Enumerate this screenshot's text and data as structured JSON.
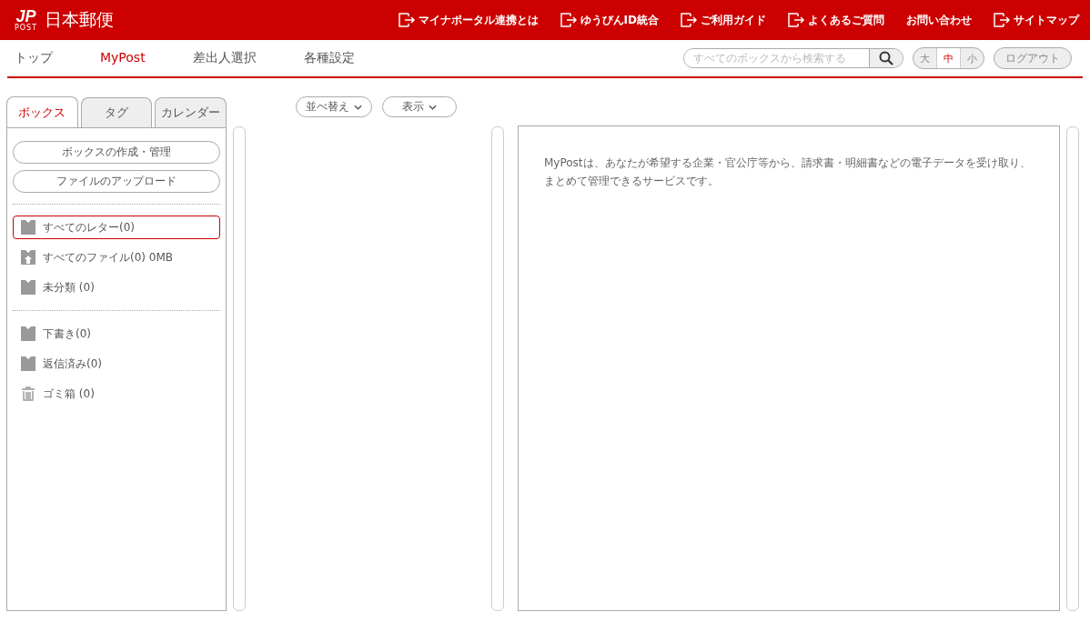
{
  "header": {
    "logo_mark": "JP",
    "logo_sub": "POST",
    "logo_text": "日本郵便",
    "links": [
      {
        "label": "マイナポータル連携とは",
        "external": true
      },
      {
        "label": "ゆうびんID統合",
        "external": true
      },
      {
        "label": "ご利用ガイド",
        "external": true
      },
      {
        "label": "よくあるご質問",
        "external": true
      },
      {
        "label": "お問い合わせ",
        "external": false
      },
      {
        "label": "サイトマップ",
        "external": true
      }
    ]
  },
  "nav": {
    "items": [
      {
        "label": "トップ",
        "selected": false
      },
      {
        "label": "MyPost",
        "selected": true
      },
      {
        "label": "差出人選択",
        "selected": false
      },
      {
        "label": "各種設定",
        "selected": false
      }
    ],
    "search": {
      "placeholder": "すべてのボックスから検索する"
    },
    "font_sizes": [
      {
        "label": "大",
        "selected": false
      },
      {
        "label": "中",
        "selected": true
      },
      {
        "label": "小",
        "selected": false
      }
    ],
    "logout": "ログアウト"
  },
  "sidebar": {
    "tabs": [
      {
        "label": "ボックス",
        "selected": true
      },
      {
        "label": "タグ",
        "selected": false
      },
      {
        "label": "カレンダー",
        "selected": false
      }
    ],
    "buttons": [
      "ボックスの作成・管理",
      "ファイルのアップロード"
    ],
    "groups": [
      [
        {
          "kind": "folder",
          "label": "すべてのレター(0)",
          "selected": true
        },
        {
          "kind": "upload",
          "label": "すべてのファイル(0) 0MB",
          "selected": false
        },
        {
          "kind": "folder",
          "label": "未分類 (0)",
          "selected": false
        }
      ],
      [
        {
          "kind": "folder",
          "label": "下書き(0)",
          "selected": false
        },
        {
          "kind": "folder",
          "label": "返信済み(0)",
          "selected": false
        },
        {
          "kind": "trash",
          "label": "ゴミ箱 (0)",
          "selected": false
        }
      ]
    ]
  },
  "toolbar": [
    "並べ替え",
    "表示"
  ],
  "content": {
    "text": "MyPostは、あなたが希望する企業・官公庁等から、請求書・明細書などの電子データを受け取り、まとめて管理できるサービスです。"
  }
}
